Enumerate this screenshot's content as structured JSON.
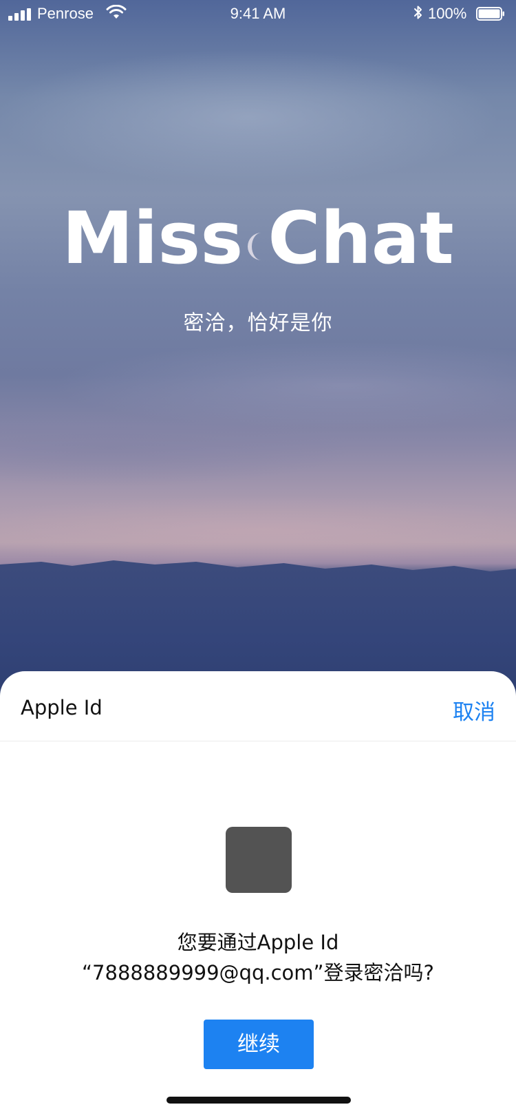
{
  "status_bar": {
    "carrier": "Penrose",
    "time": "9:41 AM",
    "battery_percent": "100%",
    "battery_level": 1.0,
    "icons": [
      "signal-icon",
      "wifi-icon",
      "bluetooth-icon",
      "battery-icon"
    ]
  },
  "hero": {
    "title": "Miss Chat",
    "subtitle": "密洽，恰好是你",
    "icon": "moon-icon"
  },
  "sheet": {
    "title": "Apple Id",
    "cancel_label": "取消",
    "app_icon": "app-icon",
    "prompt_line1": "您要通过Apple Id",
    "prompt_line2": "“7888889999@qq.com”登录密洽吗?",
    "continue_label": "继续"
  },
  "colors": {
    "accent": "#1d82f1",
    "sheet_background": "#ffffff",
    "app_icon": "#535353"
  }
}
